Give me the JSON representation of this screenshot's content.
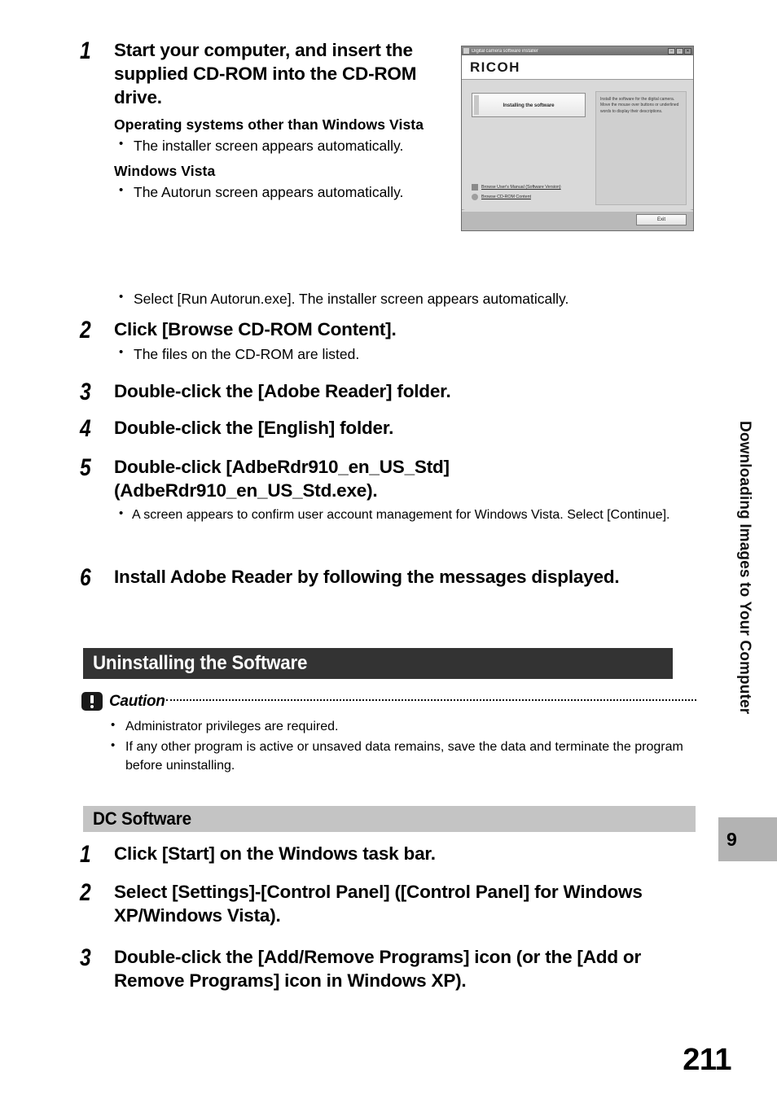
{
  "page": {
    "number": "211",
    "side_tab_label": "Downloading Images to Your Computer",
    "side_tab_chapter": "9"
  },
  "steps_install": [
    {
      "num": "1",
      "title": "Start your computer, and insert the supplied CD-ROM into the CD-ROM drive.",
      "subheads": [
        {
          "heading": "Operating systems other than Windows Vista",
          "bullets": [
            "The installer screen appears automatically."
          ]
        },
        {
          "heading": "Windows Vista",
          "bullets": [
            "The Autorun screen appears automatically."
          ]
        }
      ],
      "trailing_bullets": [
        "Select [Run Autorun.exe]. The installer screen appears automatically."
      ]
    },
    {
      "num": "2",
      "title": "Click [Browse CD-ROM Content].",
      "bullets": [
        "The files on the CD-ROM are listed."
      ]
    },
    {
      "num": "3",
      "title": "Double-click the [Adobe Reader] folder.",
      "bullets": []
    },
    {
      "num": "4",
      "title": "Double-click the [English] folder.",
      "bullets": []
    },
    {
      "num": "5",
      "title": "Double-click [AdbeRdr910_en_US_Std] (AdbeRdr910_en_US_Std.exe).",
      "bullets": [
        "A screen appears to confirm user account management for Windows Vista. Select [Continue]."
      ]
    },
    {
      "num": "6",
      "title": "Install Adobe Reader by following the messages displayed.",
      "bullets": []
    }
  ],
  "installer_window": {
    "title": "Digital camera software installer",
    "brand": "RICOH",
    "minimize_glyph": "–",
    "maximize_glyph": "▫",
    "close_glyph": "✕",
    "main_button": "Installing the software",
    "description": "Install the software for the digital camera. Move the mouse over buttons or underlined words to display their descriptions.",
    "links": [
      "Browse User's Manual (Software Version)",
      "Browse CD-ROM Content"
    ],
    "exit_button": "Exit"
  },
  "section": {
    "title": "Uninstalling the Software"
  },
  "caution": {
    "label": "Caution",
    "bullets": [
      "Administrator privileges are required.",
      "If any other program is active or unsaved data remains, save the data and terminate the program before uninstalling."
    ]
  },
  "subsection": {
    "title": "DC Software"
  },
  "steps_uninstall": [
    {
      "num": "1",
      "title": "Click [Start] on the Windows task bar."
    },
    {
      "num": "2",
      "title": "Select [Settings]-[Control Panel] ([Control Panel] for Windows XP/Windows Vista)."
    },
    {
      "num": "3",
      "title": "Double-click the [Add/Remove Programs] icon (or the [Add or Remove Programs] icon in Windows XP)."
    }
  ]
}
